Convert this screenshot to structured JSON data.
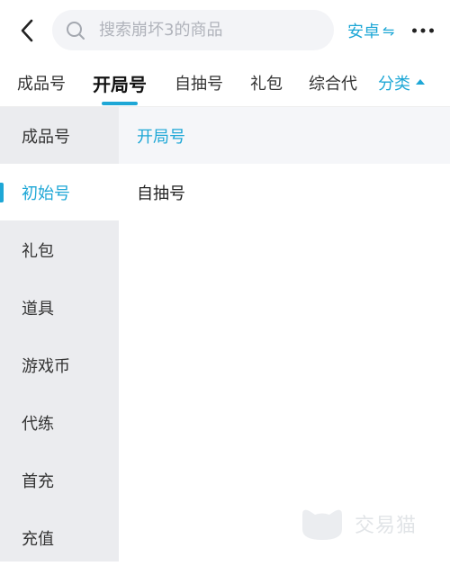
{
  "header": {
    "search_placeholder": "搜索崩坏3的商品",
    "platform_label": "安卓",
    "icons": {
      "back": "chevron-left-icon",
      "search": "search-icon",
      "swap": "swap-icon",
      "more": "more-icon"
    }
  },
  "tabs": [
    {
      "label": "成品号",
      "active": false
    },
    {
      "label": "开局号",
      "active": true
    },
    {
      "label": "自抽号",
      "active": false
    },
    {
      "label": "礼包",
      "active": false
    },
    {
      "label": "综合代",
      "active": false
    }
  ],
  "category_tab": {
    "label": "分类"
  },
  "sidebar": {
    "items": [
      {
        "label": "成品号"
      },
      {
        "label": "初始号",
        "active": true
      },
      {
        "label": "礼包"
      },
      {
        "label": "道具"
      },
      {
        "label": "游戏币"
      },
      {
        "label": "代练"
      },
      {
        "label": "首充"
      },
      {
        "label": "充值"
      }
    ]
  },
  "panel": {
    "header": "开局号",
    "items": [
      {
        "label": "自抽号"
      }
    ]
  },
  "watermark": {
    "text": "交易猫"
  },
  "colors": {
    "accent": "#1ea7d6",
    "sidebar_bg": "#ebecef",
    "search_bg": "#f3f4f7"
  }
}
